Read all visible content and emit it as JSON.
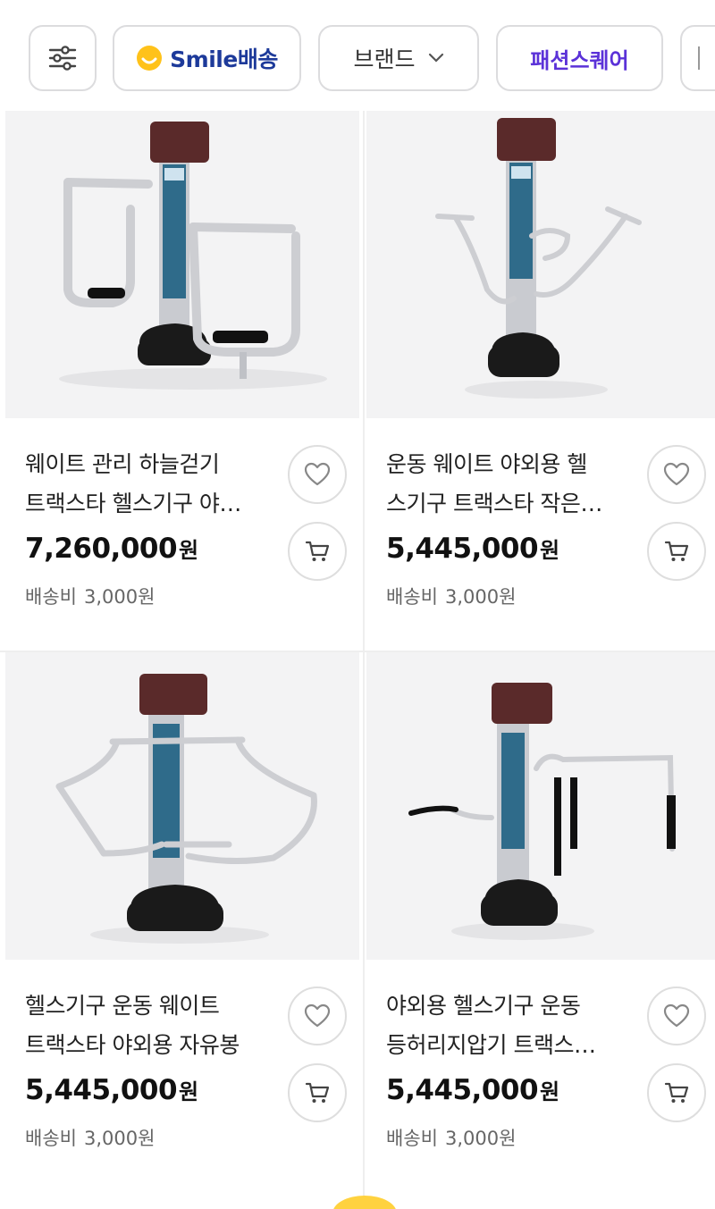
{
  "filters": {
    "filter_icon": "sliders-icon",
    "smile": {
      "brand": "Smile",
      "suffix": "배송",
      "icon": "smile-face-icon",
      "color": "#ffc21a"
    },
    "brand": {
      "label": "브랜드",
      "icon": "chevron-down-icon"
    },
    "fashion": {
      "label": "패션스퀘어",
      "color": "#5b32d8"
    }
  },
  "products": [
    {
      "title_line1": "웨이트 관리 하늘걷기",
      "title_line2": "트랙스타 헬스기구 야…",
      "price": "7,260,000",
      "currency": "원",
      "shipping_label": "배송비",
      "shipping_fee": "3,000원",
      "image": "air-walker-outdoor-equipment"
    },
    {
      "title_line1": "운동 웨이트 야외용 헬",
      "title_line2": "스기구 트랙스타 작은…",
      "price": "5,445,000",
      "currency": "원",
      "shipping_label": "배송비",
      "shipping_fee": "3,000원",
      "image": "waist-twister-outdoor-equipment"
    },
    {
      "title_line1": "헬스기구 운동 웨이트",
      "title_line2": "트랙스타 야외용 자유봉",
      "price": "5,445,000",
      "currency": "원",
      "shipping_label": "배송비",
      "shipping_fee": "3,000원",
      "image": "free-swing-outdoor-equipment"
    },
    {
      "title_line1": "야외용 헬스기구 운동",
      "title_line2": "등허리지압기 트랙스…",
      "price": "5,445,000",
      "currency": "원",
      "shipping_label": "배송비",
      "shipping_fee": "3,000원",
      "image": "back-massager-outdoor-equipment"
    }
  ],
  "icons": {
    "like": "heart-icon",
    "cart": "cart-icon"
  },
  "colors": {
    "post_cap": "#5a2a2a",
    "base": "#1a1a1a",
    "frame": "#c9cbd0",
    "panel": "#2f6b8a"
  }
}
